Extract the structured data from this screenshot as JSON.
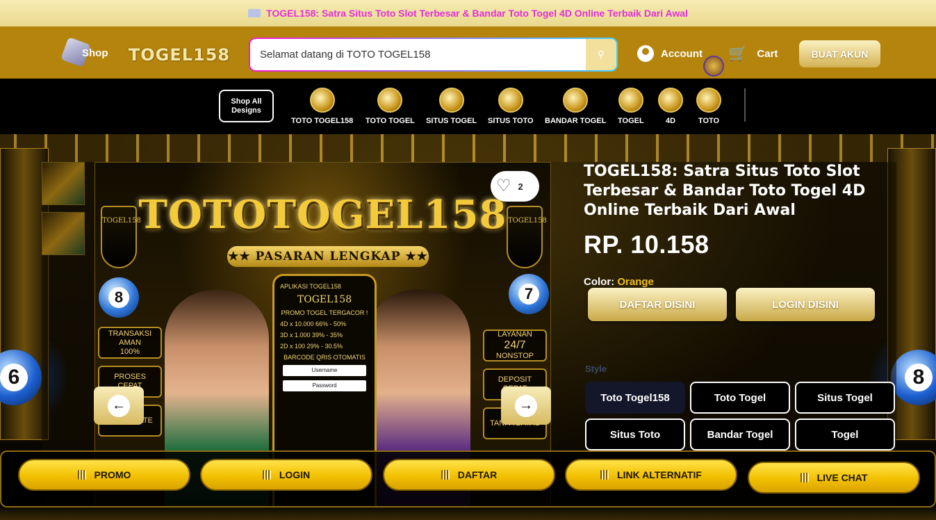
{
  "announcement": {
    "text": "TOGEL158: Satra Situs Toto Slot Terbesar & Bandar Toto Togel 4D Online Terbaik Dari Awal"
  },
  "header": {
    "shop_label": "Shop",
    "logo_text": "TOGEL158",
    "search_value": "Selamat datang di TOTO TOGEL158",
    "account_label": "Account",
    "cart_label": "Cart",
    "signup_label": "BUAT AKUN"
  },
  "catnav": {
    "shop_all_line1": "Shop All",
    "shop_all_line2": "Designs",
    "items": [
      {
        "label": "TOTO TOGEL158"
      },
      {
        "label": "TOTO TOGEL"
      },
      {
        "label": "SITUS TOGEL"
      },
      {
        "label": "SITUS TOTO"
      },
      {
        "label": "BANDAR TOGEL"
      },
      {
        "label": "TOGEL"
      },
      {
        "label": "4D"
      },
      {
        "label": "TOTO"
      }
    ]
  },
  "product": {
    "wishlist_count": "2",
    "image": {
      "title": "TOTOTOGEL158",
      "subtitle": "★★ PASARAN LENGKAP ★★",
      "phone_app": "APLIKASI TOGEL158",
      "phone_logo": "TOGEL158",
      "phone_promo": "PROMO TOGEL TERGACOR !",
      "phone_rows": [
        "4D x 10.000   66% - 50%",
        "3D x 1.000   39% - 35%",
        "2D x 100   29% - 30.5%"
      ],
      "phone_barcode": "BARCODE QRIS OTOMATIS",
      "phone_username": "Username",
      "phone_password": "Password",
      "badge_transaksi": [
        "TRANSAKSI",
        "AMAN",
        "100%"
      ],
      "badge_proses": [
        "PROSES",
        "CEPAT"
      ],
      "badge_layanan": [
        "LAYANAN",
        "24/7",
        "NONSTOP"
      ],
      "badge_deposit": [
        "DEPOSIT",
        "CEPAT"
      ],
      "badge_terupdate": "TERUPDATE",
      "badge_tanpa": "TANPA BATAS",
      "shield_text": "TOGEL158",
      "ball_left": "8",
      "ball_right": "7"
    },
    "title": "TOGEL158: Satra Situs Toto Slot Terbesar & Bandar Toto Togel 4D Online Terbaik Dari Awal",
    "price": "RP. 10.158",
    "color_label": "Color:",
    "color_value": "Orange",
    "btn_daftar": "DAFTAR DISINI",
    "btn_login": "LOGIN DISINI",
    "style_label": "Style",
    "styles": [
      {
        "label": "Toto Togel158"
      },
      {
        "label": "Toto Togel"
      },
      {
        "label": "Situs Togel"
      },
      {
        "label": "Situs Toto"
      },
      {
        "label": "Bandar Togel"
      },
      {
        "label": "Togel"
      }
    ]
  },
  "hero": {
    "ball_left": "6",
    "ball_right": "8"
  },
  "bottom_nav": [
    {
      "label": "PROMO"
    },
    {
      "label": "LOGIN"
    },
    {
      "label": "DAFTAR"
    },
    {
      "label": "LINK ALTERNATIF"
    },
    {
      "label": "LIVE CHAT"
    }
  ]
}
